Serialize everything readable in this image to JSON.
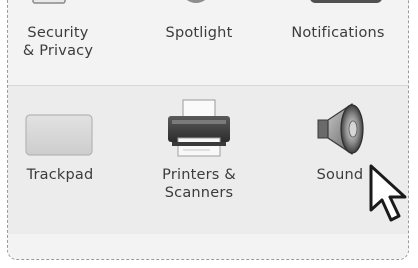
{
  "preferences": {
    "top_row": [
      {
        "label": "Security\n& Privacy",
        "icon": "security-icon"
      },
      {
        "label": "Spotlight",
        "icon": "spotlight-icon"
      },
      {
        "label": "Notifications",
        "icon": "notifications-icon"
      }
    ],
    "middle_row": [
      {
        "label": "Trackpad",
        "icon": "trackpad-icon"
      },
      {
        "label": "Printers &\nScanners",
        "icon": "printer-icon"
      },
      {
        "label": "Sound",
        "icon": "speaker-icon"
      }
    ]
  },
  "colors": {
    "row_light": "#f3f3f3",
    "row_dark": "#ececec",
    "label_text": "#3c3c3c"
  }
}
